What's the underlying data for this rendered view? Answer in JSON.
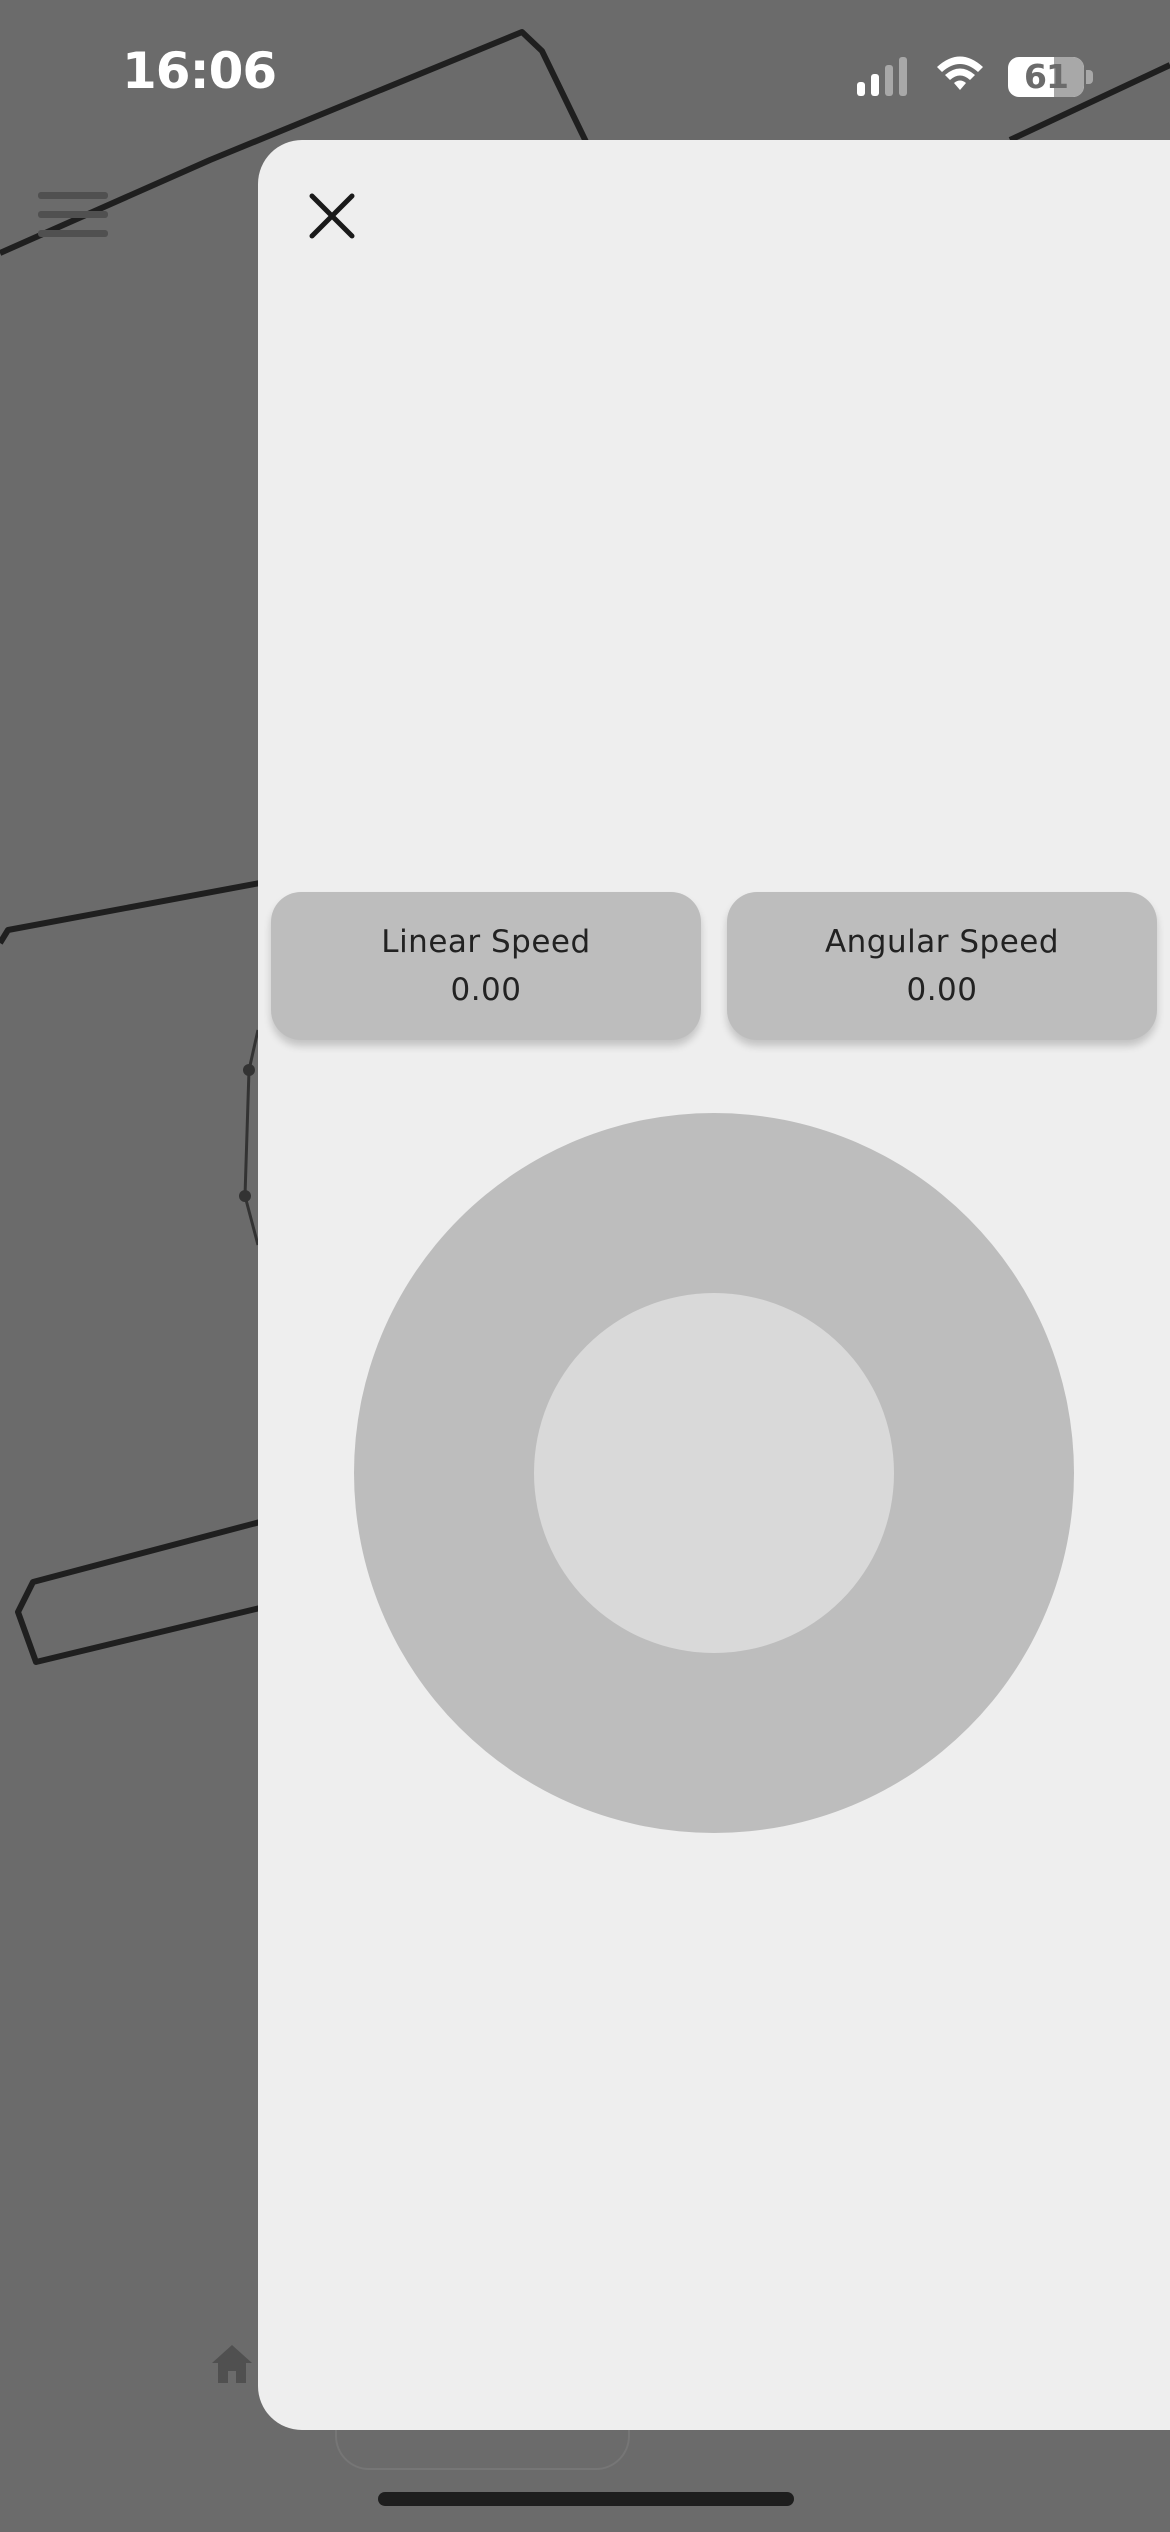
{
  "status_bar": {
    "time": "16:06",
    "battery_level": "61",
    "icons": [
      "cellular-signal-icon",
      "wifi-icon",
      "battery-icon"
    ]
  },
  "app": {
    "menu_icon": "hamburger-menu-icon",
    "home_tab_icon": "home-icon"
  },
  "modal": {
    "close_icon": "close-icon",
    "linear_speed": {
      "label": "Linear Speed",
      "value": "0.00"
    },
    "angular_speed": {
      "label": "Angular Speed",
      "value": "0.00"
    },
    "joystick": {
      "name": "joystick"
    }
  },
  "colors": {
    "backdrop": "#6b6b6b",
    "modal_background": "#eeeeee",
    "card_background": "#bdbdbd",
    "joystick_base": "#bdbdbd",
    "joystick_knob": "#d9d9d9",
    "text": "#222222"
  }
}
